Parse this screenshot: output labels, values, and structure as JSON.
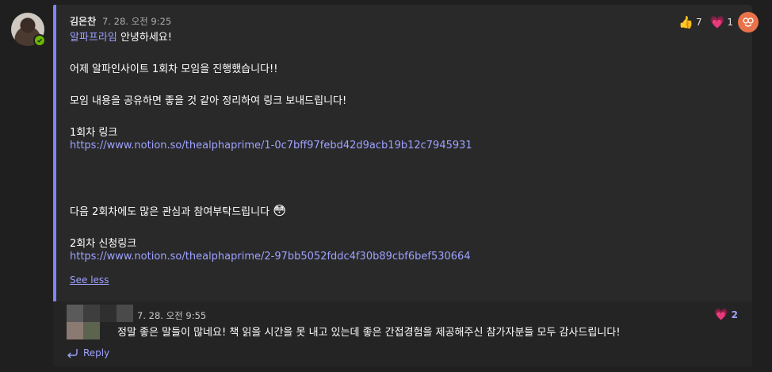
{
  "message": {
    "sender": "김은찬",
    "time": "7. 28. 오전 9:25",
    "mention": "알파프라임",
    "greeting": " 안녕하세요!",
    "line1": "어제 알파인사이트 1회차 모임을 진행했습니다!!",
    "line2": "모임 내용을 공유하면 좋을 것 같아 정리하여 링크 보내드립니다!",
    "line3": "1회차 링크",
    "link1": "https://www.notion.so/thealphaprime/1-0c7bff97febd42d9acb19b12c7945931",
    "line4": "다음 2회차에도 많은 관심과 참여부탁드립니다",
    "line4_emoji": "😳",
    "line5": "2회차 신청링크",
    "link2": "https://www.notion.so/thealphaprime/2-97bb5052fddc4f30b89cbf6bef530664",
    "see_less": "See less"
  },
  "reactions": [
    {
      "icon": "thumbs-up",
      "emoji": "👍",
      "count": "7"
    },
    {
      "icon": "heart",
      "emoji": "💗",
      "count": "1"
    }
  ],
  "reply": {
    "time": "7. 28. 오전 9:55",
    "text": "정말 좋은 말들이 많네요! 책 읽을 시간을 못 내고 있는데 좋은 간접경험을 제공해주신 참가자분들 모두 감사드립니다!",
    "reaction_emoji": "💗",
    "reaction_count": "2"
  },
  "reply_button": "Reply",
  "colors": {
    "accent": "#7f85f5",
    "link": "#9ea2ff",
    "presence": "#6bb700",
    "react_button": "#e8734a"
  }
}
